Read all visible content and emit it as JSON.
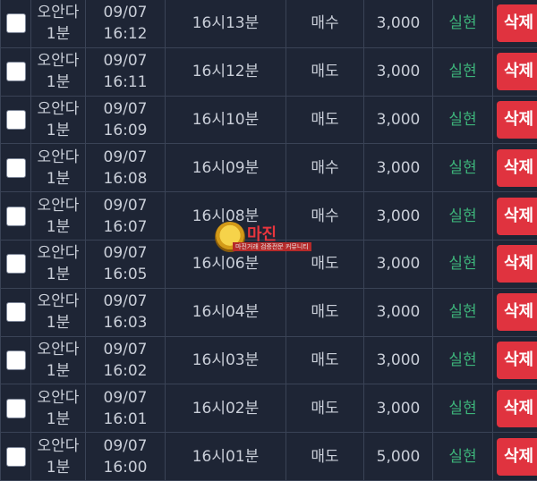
{
  "rows": [
    {
      "game": [
        "오안다",
        "1분"
      ],
      "date": "09/07",
      "time": "16:12",
      "round": "16시13분",
      "position": "매수",
      "amount": "3,000",
      "status": "실현",
      "action": "삭제"
    },
    {
      "game": [
        "오안다",
        "1분"
      ],
      "date": "09/07",
      "time": "16:11",
      "round": "16시12분",
      "position": "매도",
      "amount": "3,000",
      "status": "실현",
      "action": "삭제"
    },
    {
      "game": [
        "오안다",
        "1분"
      ],
      "date": "09/07",
      "time": "16:09",
      "round": "16시10분",
      "position": "매도",
      "amount": "3,000",
      "status": "실현",
      "action": "삭제"
    },
    {
      "game": [
        "오안다",
        "1분"
      ],
      "date": "09/07",
      "time": "16:08",
      "round": "16시09분",
      "position": "매수",
      "amount": "3,000",
      "status": "실현",
      "action": "삭제"
    },
    {
      "game": [
        "오안다",
        "1분"
      ],
      "date": "09/07",
      "time": "16:07",
      "round": "16시08분",
      "position": "매수",
      "amount": "3,000",
      "status": "실현",
      "action": "삭제"
    },
    {
      "game": [
        "오안다",
        "1분"
      ],
      "date": "09/07",
      "time": "16:05",
      "round": "16시06분",
      "position": "매도",
      "amount": "3,000",
      "status": "실현",
      "action": "삭제"
    },
    {
      "game": [
        "오안다",
        "1분"
      ],
      "date": "09/07",
      "time": "16:03",
      "round": "16시04분",
      "position": "매도",
      "amount": "3,000",
      "status": "실현",
      "action": "삭제"
    },
    {
      "game": [
        "오안다",
        "1분"
      ],
      "date": "09/07",
      "time": "16:02",
      "round": "16시03분",
      "position": "매도",
      "amount": "3,000",
      "status": "실현",
      "action": "삭제"
    },
    {
      "game": [
        "오안다",
        "1분"
      ],
      "date": "09/07",
      "time": "16:01",
      "round": "16시02분",
      "position": "매도",
      "amount": "3,000",
      "status": "실현",
      "action": "삭제"
    },
    {
      "game": [
        "오안다",
        "1분"
      ],
      "date": "09/07",
      "time": "16:00",
      "round": "16시01분",
      "position": "매도",
      "amount": "5,000",
      "status": "실현",
      "action": "삭제"
    }
  ],
  "watermark": {
    "title": "마진",
    "subtitle": "마진거래 검증전문 커뮤니티"
  },
  "colors": {
    "background": "#1e2535",
    "delete_button": "#e0333f",
    "status_text": "#3db37a",
    "border": "#3a4356"
  }
}
